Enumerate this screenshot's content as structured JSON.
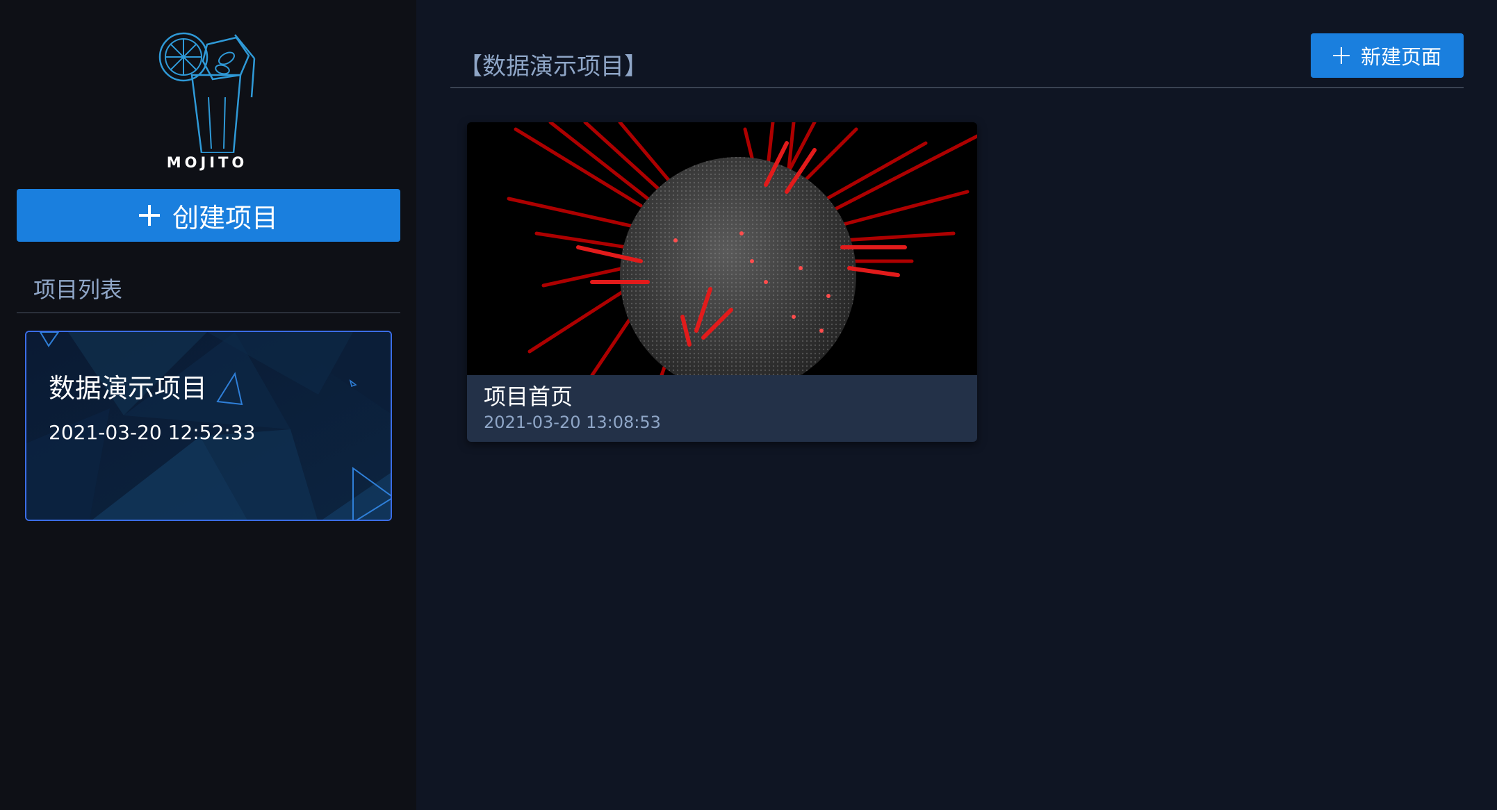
{
  "sidebar": {
    "logo_text": "MOJITO",
    "create_button_label": "创建项目",
    "list_title": "项目列表",
    "projects": [
      {
        "name": "数据演示项目",
        "created": "2021-03-20 12:52:33"
      }
    ]
  },
  "main": {
    "title": "【数据演示项目】",
    "new_page_button_label": "新建页面",
    "pages": [
      {
        "name": "项目首页",
        "updated": "2021-03-20 13:08:53",
        "thumbnail": "earth-data-globe"
      }
    ]
  },
  "colors": {
    "accent": "#1a7fde",
    "sidebar_bg": "#0e1016",
    "main_bg": "#0f1523",
    "card_border": "#3b6de6",
    "muted_text": "#8fa6c7"
  }
}
